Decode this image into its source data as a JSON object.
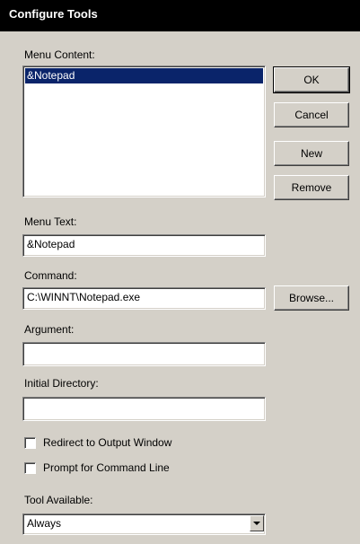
{
  "window": {
    "title": "Configure Tools"
  },
  "menu_content": {
    "label": "Menu Content:",
    "items": [
      "&Notepad"
    ]
  },
  "buttons": {
    "ok": "OK",
    "cancel": "Cancel",
    "new": "New",
    "remove": "Remove",
    "browse": "Browse..."
  },
  "menu_text": {
    "label": "Menu Text:",
    "value": "&Notepad"
  },
  "command": {
    "label": "Command:",
    "value": "C:\\WINNT\\Notepad.exe"
  },
  "argument": {
    "label": "Argument:",
    "value": ""
  },
  "initial_directory": {
    "label": "Initial Directory:",
    "value": ""
  },
  "options": {
    "redirect": {
      "label": "Redirect to Output Window",
      "checked": false
    },
    "prompt": {
      "label": "Prompt for Command Line",
      "checked": false
    }
  },
  "tool_available": {
    "label": "Tool Available:",
    "value": "Always"
  },
  "colors": {
    "selection": "#0a246a",
    "face": "#d4d0c8",
    "titlebar": "#000000"
  }
}
